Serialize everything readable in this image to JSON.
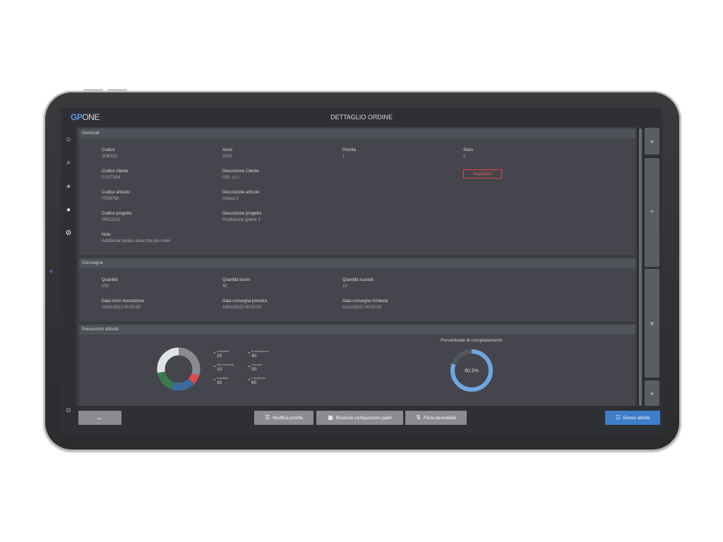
{
  "app": {
    "logo_gp": "GP",
    "logo_one": "ONE",
    "title": "DETTAGLIO ORDINE"
  },
  "sidebar": {
    "items": [
      {
        "name": "home-icon",
        "glyph": "⌂"
      },
      {
        "name": "search-icon",
        "glyph": "⌕"
      },
      {
        "name": "add-icon",
        "glyph": "+"
      },
      {
        "name": "circle-icon",
        "glyph": "●"
      },
      {
        "name": "gear-icon",
        "glyph": "⚙"
      }
    ],
    "user_glyph": "☺"
  },
  "generali": {
    "header": "Generali",
    "fields": [
      {
        "label": "Codice",
        "value": "JOB123"
      },
      {
        "label": "Anno",
        "value": "2022"
      },
      {
        "label": "Priorità",
        "value": "1"
      },
      {
        "label": "Stato",
        "value": "2"
      },
      {
        "label": "Codice cliente",
        "value": "CUST456"
      },
      {
        "label": "Descrizione Cliente",
        "value": "OSL s.r.l."
      },
      {
        "label": "Codice articolo",
        "value": "ITEM789"
      },
      {
        "label": "Descrizione articolo",
        "value": "Ghiera 2"
      },
      {
        "label": "Codice progetto",
        "value": "PROJ101"
      },
      {
        "label": "Descrizione progetto",
        "value": "Produzione ghiere 2"
      },
      {
        "label": "Note",
        "value": "Additional details about the job order"
      }
    ],
    "badge": "Segnalato"
  },
  "consegna": {
    "header": "Consegna",
    "fields": [
      {
        "label": "Quantità",
        "value": "100"
      },
      {
        "label": "Quantità buoni",
        "value": "90"
      },
      {
        "label": "Quantità scartati",
        "value": "10"
      },
      {
        "label": "Data inizio lavorazione",
        "value": "15/01/2022 00:00:00"
      },
      {
        "label": "Data consegna prevista",
        "value": "18/01/2023 00:00:00"
      },
      {
        "label": "Data consegna richiesta",
        "value": "31/12/2022 00:00:00"
      }
    ]
  },
  "resoconto": {
    "header": "Resoconto attività",
    "legend": [
      {
        "label": "Lavorabili",
        "value": "20"
      },
      {
        "label": "In lavorazione",
        "value": "40"
      },
      {
        "label": "Non lavorabili",
        "value": "10"
      },
      {
        "label": "Lavorate",
        "value": "50"
      },
      {
        "label": "Annullate",
        "value": "30"
      },
      {
        "label": "Completate",
        "value": "60"
      }
    ],
    "donut_colors": [
      "#8a8b90",
      "#e04a4a",
      "#3e6b9e",
      "#3a7a4e",
      "#dfe3e6"
    ],
    "percent_title": "Percentuale di completamento",
    "percent_value": 80.3,
    "percent_label": "80.3%",
    "ring_color": "#6ea7df",
    "ring_track": "#55575e"
  },
  "rail": {
    "top_top": "»",
    "up": "^",
    "down": "v",
    "bottom_bottom": "«"
  },
  "bottom": {
    "back_glyph": "←",
    "modifica": "Modifica priorità",
    "ricalcola": "Ricalcola configurazioni pallet",
    "forza": "Forza lavorabilità",
    "elenco": "Elenco attività",
    "accent": "#3e7dc9"
  }
}
